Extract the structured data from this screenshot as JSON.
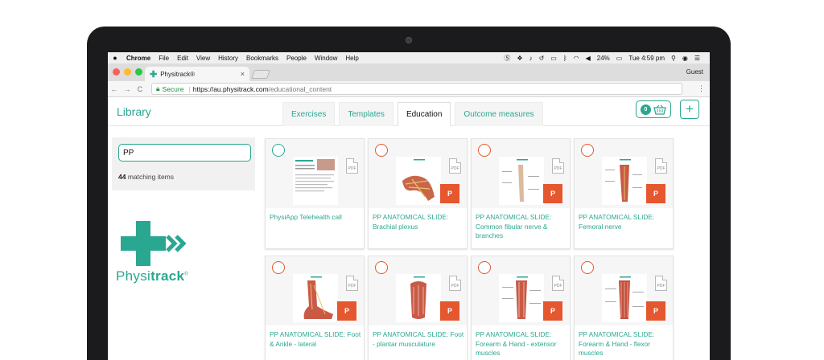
{
  "menubar": {
    "apple": "",
    "items": [
      "Chrome",
      "File",
      "Edit",
      "View",
      "History",
      "Bookmarks",
      "People",
      "Window",
      "Help"
    ],
    "battery": "24%",
    "clock": "Tue 4:59 pm"
  },
  "browser": {
    "tab_title": "Physitrack®",
    "tab_close": "×",
    "guest": "Guest",
    "secure_label": "Secure",
    "url_host": "https://au.physitrack.com",
    "url_path": "/educational_content",
    "back": "←",
    "forward": "→",
    "reload": "C",
    "menu": "⋮"
  },
  "app": {
    "library_title": "Library",
    "tabs": [
      "Exercises",
      "Templates",
      "Education",
      "Outcome measures"
    ],
    "active_tab": "Education",
    "basket_count": "0",
    "add_label": "+"
  },
  "sidebar": {
    "search_value": "PP",
    "match_count": "44",
    "match_suffix": "matching items",
    "logo_text_a": "Physi",
    "logo_text_b": "track",
    "logo_tm": "®"
  },
  "cards": [
    {
      "title": "PhysiApp Telehealth call",
      "selected_style": "teal",
      "pdf": "PDF",
      "pp": ""
    },
    {
      "title": "PP ANATOMICAL SLIDE: Brachial plexus",
      "selected_style": "orange",
      "pdf": "PDF",
      "pp": "P"
    },
    {
      "title": "PP ANATOMICAL SLIDE: Common fibular nerve & branches",
      "selected_style": "orange",
      "pdf": "PDF",
      "pp": "P"
    },
    {
      "title": "PP ANATOMICAL SLIDE: Femoral nerve",
      "selected_style": "orange",
      "pdf": "PDF",
      "pp": "P"
    },
    {
      "title": "PP ANATOMICAL SLIDE: Foot & Ankle - lateral",
      "selected_style": "orange",
      "pdf": "PDF",
      "pp": "P"
    },
    {
      "title": "PP ANATOMICAL SLIDE: Foot - plantar musculature",
      "selected_style": "orange",
      "pdf": "PDF",
      "pp": "P"
    },
    {
      "title": "PP ANATOMICAL SLIDE: Forearm & Hand - extensor muscles",
      "selected_style": "orange",
      "pdf": "PDF",
      "pp": "P"
    },
    {
      "title": "PP ANATOMICAL SLIDE: Forearm & Hand - flexor muscles",
      "selected_style": "orange",
      "pdf": "PDF",
      "pp": "P"
    }
  ],
  "colors": {
    "brand": "#2aa791",
    "accent": "#e5572e"
  }
}
